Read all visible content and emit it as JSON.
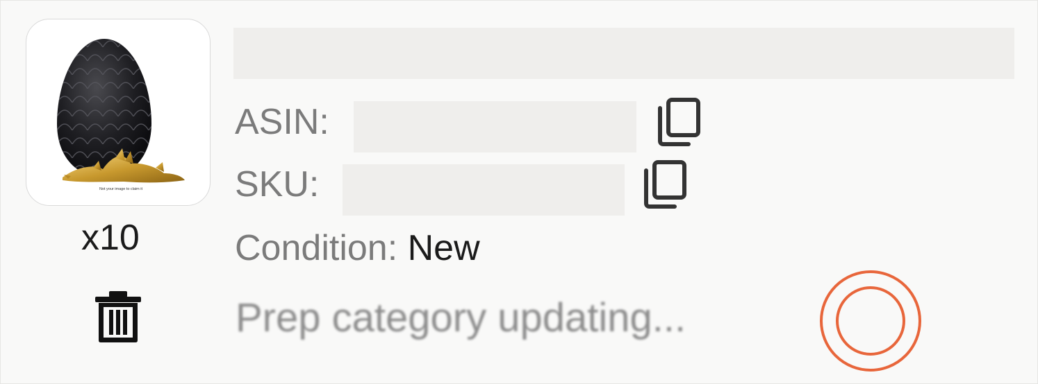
{
  "item": {
    "quantity_text": "x10",
    "image_caption": "Not your image to claim it",
    "asin_label": "ASIN:",
    "sku_label": "SKU:",
    "condition_label": "Condition:",
    "condition_value": "New",
    "prep_status": "Prep category updating...",
    "icons": {
      "trash": "trash-icon",
      "copy": "copy-icon",
      "spinner": "loading-spinner-icon"
    },
    "colors": {
      "accent_spinner": "#e8663b",
      "label_gray": "#7b7b7b",
      "value_dark": "#1b1b1b",
      "redaction": "#efeeec"
    }
  }
}
